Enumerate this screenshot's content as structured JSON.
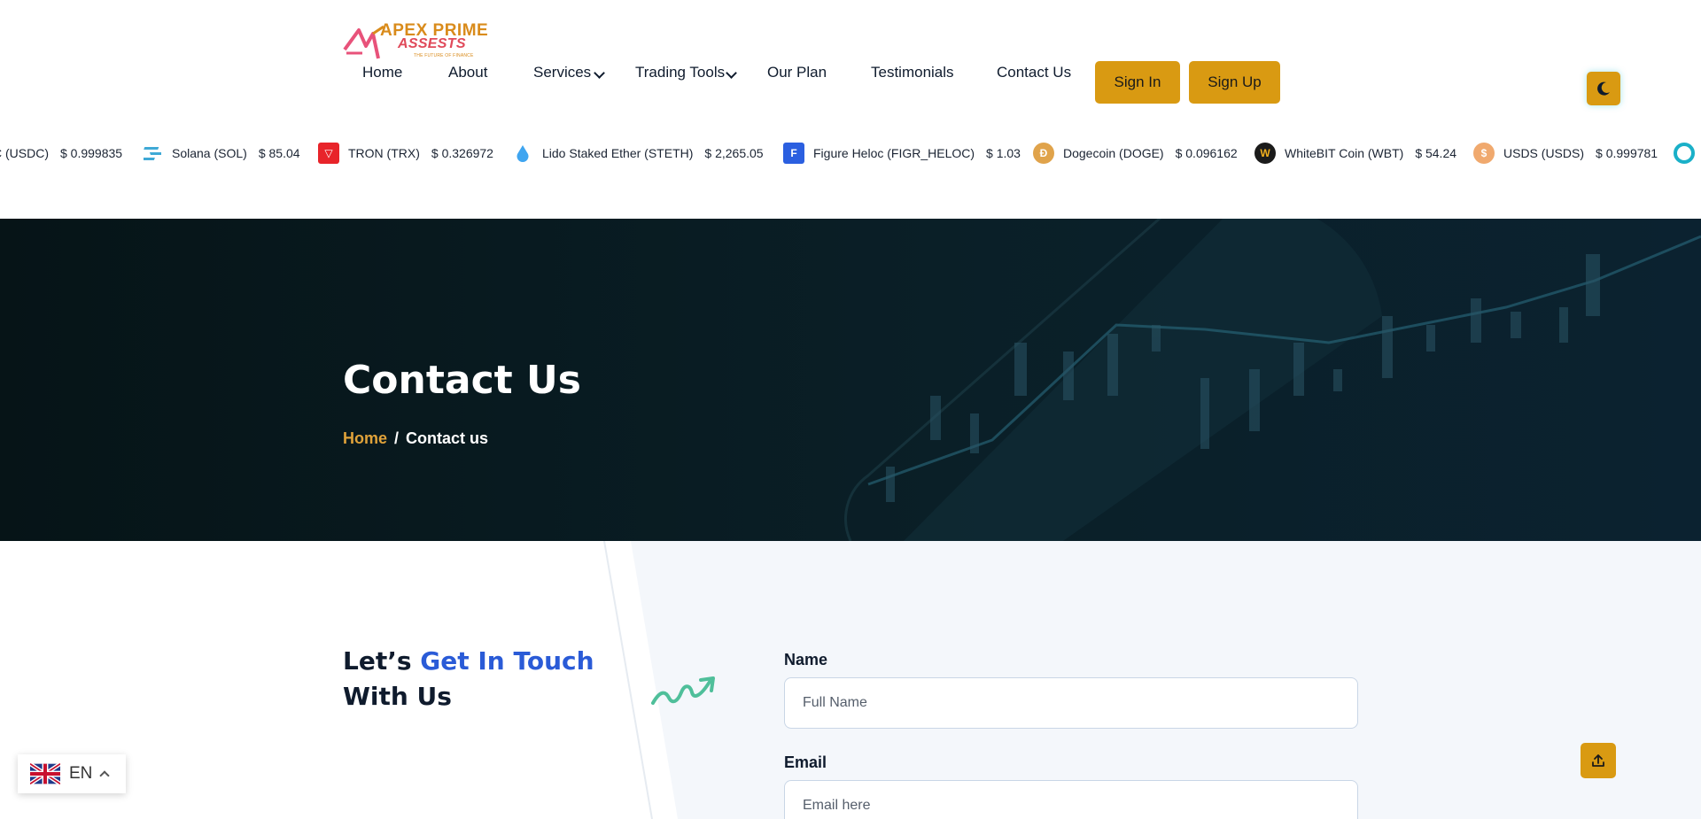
{
  "brand": {
    "line1": "APEX PRIME",
    "line2": "ASSESTS",
    "tagline": "THE FUTURE OF FINANCE"
  },
  "nav": {
    "items": [
      {
        "label": "Home",
        "dropdown": false
      },
      {
        "label": "About",
        "dropdown": false
      },
      {
        "label": "Services",
        "dropdown": true
      },
      {
        "label": "Trading Tools",
        "dropdown": true
      },
      {
        "label": "Our Plan",
        "dropdown": false
      },
      {
        "label": "Testimonials",
        "dropdown": false
      },
      {
        "label": "Contact Us",
        "dropdown": false
      }
    ],
    "sign_in": "Sign In",
    "sign_up": "Sign Up",
    "theme_toggle_icon": "moon-icon"
  },
  "ticker": [
    {
      "name": "C (USDC)",
      "price": "$ 0.999835",
      "icon": "usdc-icon",
      "color": "#2775ca"
    },
    {
      "name": "Solana (SOL)",
      "price": "$ 85.04",
      "icon": "solana-icon",
      "color": "#2fa9d6"
    },
    {
      "name": "TRON (TRX)",
      "price": "$ 0.326972",
      "icon": "tron-icon",
      "color": "#e8242a"
    },
    {
      "name": "Lido Staked Ether (STETH)",
      "price": "$ 2,265.05",
      "icon": "lido-icon",
      "color": "#3fa5f0"
    },
    {
      "name": "Figure Heloc (FIGR_HELOC)",
      "price": "$ 1.03",
      "icon": "figure-icon",
      "color": "#2b5fe0"
    },
    {
      "name": "Dogecoin (DOGE)",
      "price": "$ 0.096162",
      "icon": "doge-icon",
      "color": "#e0a34b"
    },
    {
      "name": "WhiteBIT Coin (WBT)",
      "price": "$ 54.24",
      "icon": "whitebit-icon",
      "color": "#1b1b1b"
    },
    {
      "name": "USDS (USDS)",
      "price": "$ 0.999781",
      "icon": "usds-icon",
      "color": "#f0a96e"
    },
    {
      "name": "",
      "price": "",
      "icon": "ring-icon",
      "color": "#1ab0c8"
    }
  ],
  "hero": {
    "title": "Contact Us",
    "breadcrumb": {
      "home": "Home",
      "separator": "/",
      "current": "Contact us"
    }
  },
  "contact": {
    "heading_a": "Let’s",
    "heading_highlight": "Get In Touch",
    "heading_b": "With Us",
    "name_label": "Name",
    "name_placeholder": "Full Name",
    "email_label": "Email",
    "email_placeholder": "Email here"
  },
  "language": {
    "code": "EN",
    "flag": "uk-flag-icon"
  },
  "colors": {
    "accent": "#d99a12",
    "hero_bg": "#081b22",
    "highlight": "#2a5bd7",
    "breadcrumb_home": "#e0a23a"
  }
}
